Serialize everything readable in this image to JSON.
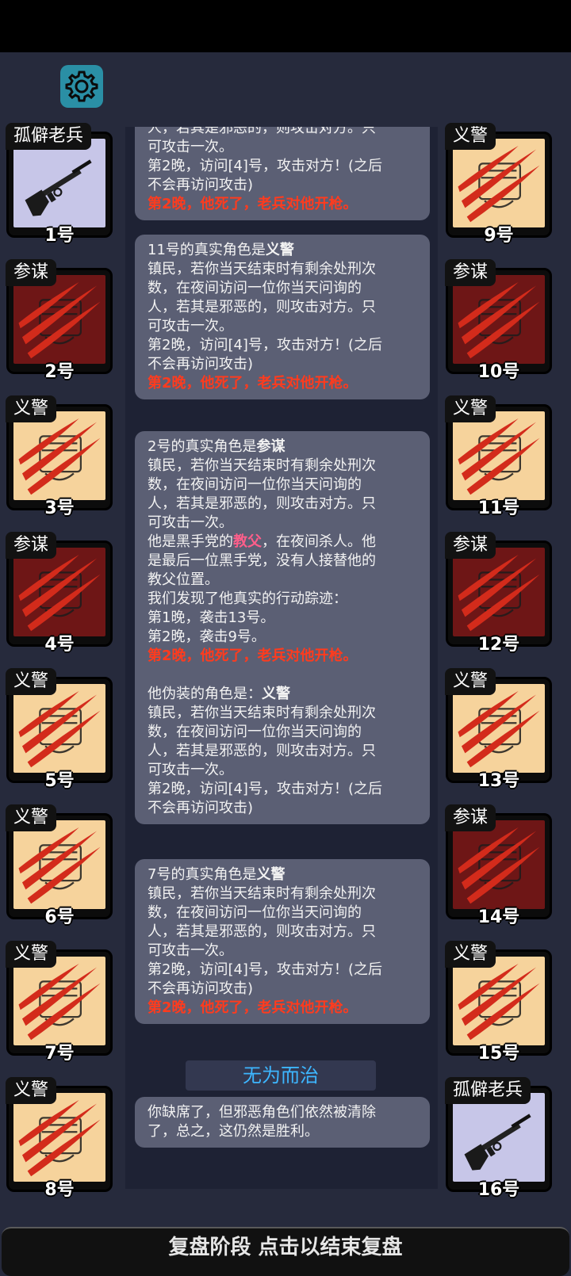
{
  "players": [
    {
      "num": "1号",
      "role": "孤僻老兵",
      "type": "veteran"
    },
    {
      "num": "2号",
      "role": "参谋",
      "type": "consigliere"
    },
    {
      "num": "3号",
      "role": "义警",
      "type": "vigilante"
    },
    {
      "num": "4号",
      "role": "参谋",
      "type": "consigliere"
    },
    {
      "num": "5号",
      "role": "义警",
      "type": "vigilante"
    },
    {
      "num": "6号",
      "role": "义警",
      "type": "vigilante"
    },
    {
      "num": "7号",
      "role": "义警",
      "type": "vigilante"
    },
    {
      "num": "8号",
      "role": "义警",
      "type": "vigilante"
    },
    {
      "num": "9号",
      "role": "义警",
      "type": "vigilante"
    },
    {
      "num": "10号",
      "role": "参谋",
      "type": "consigliere"
    },
    {
      "num": "11号",
      "role": "义警",
      "type": "vigilante"
    },
    {
      "num": "12号",
      "role": "参谋",
      "type": "consigliere"
    },
    {
      "num": "13号",
      "role": "义警",
      "type": "vigilante"
    },
    {
      "num": "14号",
      "role": "参谋",
      "type": "consigliere"
    },
    {
      "num": "15号",
      "role": "义警",
      "type": "vigilante"
    },
    {
      "num": "16号",
      "role": "孤僻老兵",
      "type": "veteran"
    }
  ],
  "log": {
    "b1_cut": "人，若其是邪恶的，则攻击对方。只",
    "b1_l1": "可攻击一次。",
    "b1_l2": "第2晚，访问[4]号，攻击对方！(之后",
    "b1_l3": "不会再访问攻击)",
    "b1_death": "第2晚，他死了，老兵对他开枪。",
    "b2_pre": "11号的真实角色是",
    "b2_role": "义警",
    "b2_l1": "镇民，若你当天结束时有剩余处刑次",
    "b2_l2": "数，在夜间访问一位你当天问询的",
    "b2_l3": "人，若其是邪恶的，则攻击对方。只",
    "b2_l4": "可攻击一次。",
    "b2_l5": "第2晚，访问[4]号，攻击对方！(之后",
    "b2_l6": "不会再访问攻击)",
    "b2_death": "第2晚，他死了，老兵对他开枪。",
    "b3_pre": "2号的真实角色是",
    "b3_role": "参谋",
    "b3_l1": "镇民，若你当天结束时有剩余处刑次",
    "b3_l2": "数，在夜间访问一位你当天问询的",
    "b3_l3": "人，若其是邪恶的，则攻击对方。只",
    "b3_l4": "可攻击一次。",
    "b3_l5a": "他是黑手党的",
    "b3_gf": "教父",
    "b3_l5b": "，在夜间杀人。他",
    "b3_l6": "是最后一位黑手党，没有人接替他的",
    "b3_l7": "教父位置。",
    "b3_l8": "我们发现了他真实的行动踪迹：",
    "b3_l9": "第1晚，袭击13号。",
    "b3_l10": "第2晚，袭击9号。",
    "b3_death": "第2晚，他死了，老兵对他开枪。",
    "b3_dis_pre": "他伪装的角色是：",
    "b3_dis_role": "义警",
    "b3_l11": "镇民，若你当天结束时有剩余处刑次",
    "b3_l12": "数，在夜间访问一位你当天问询的",
    "b3_l13": "人，若其是邪恶的，则攻击对方。只",
    "b3_l14": "可攻击一次。",
    "b3_l15": "第2晚，访问[4]号，攻击对方！(之后",
    "b3_l16": "不会再访问攻击)",
    "b4_pre": "7号的真实角色是",
    "b4_role": "义警",
    "b4_l1": "镇民，若你当天结束时有剩余处刑次",
    "b4_l2": "数，在夜间访问一位你当天问询的",
    "b4_l3": "人，若其是邪恶的，则攻击对方。只",
    "b4_l4": "可攻击一次。",
    "b4_l5": "第2晚，访问[4]号，攻击对方！(之后",
    "b4_l6": "不会再访问攻击)",
    "b4_death": "第2晚，他死了，老兵对他开枪。",
    "section_title": "无为而治",
    "final_l1": "你缺席了，但邪恶角色们依然被清除",
    "final_l2": "了，总之，这仍然是胜利。"
  },
  "footer": "复盘阶段 点击以结束复盘",
  "icons": {
    "settings": "gear-icon",
    "veteran": "rifle-icon",
    "attack": "claw-scratch-icon"
  },
  "colors": {
    "background": "#262a3c",
    "settings_button": "#2a8fa5",
    "veteran_card": "#c7c6e8",
    "vigilante_card": "#f6d39c",
    "consigliere_card": "#6e1616",
    "death_text": "#ff3b1e",
    "godfather_text": "#ff5e8a",
    "section_title": "#3db6ff"
  }
}
